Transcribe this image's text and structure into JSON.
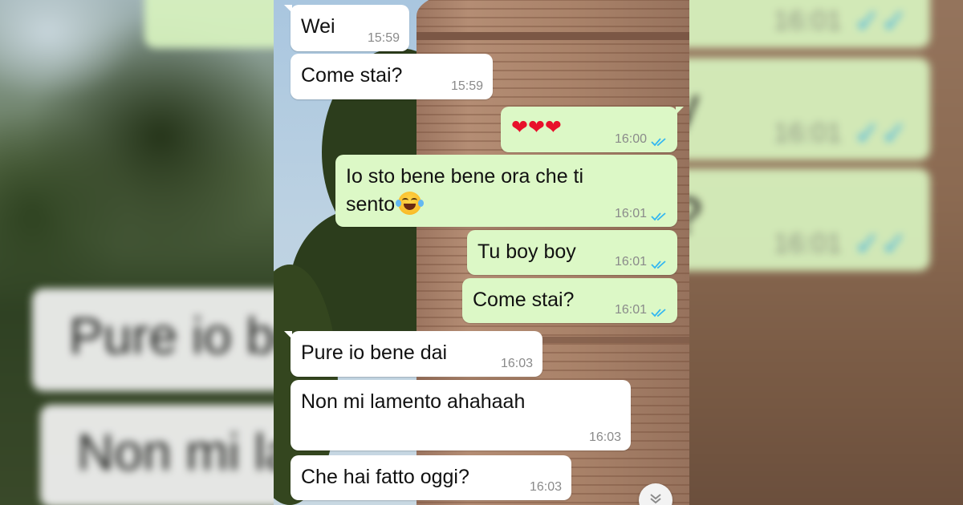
{
  "colors": {
    "incoming_bubble": "#ffffff",
    "outgoing_bubble": "#dcf8c6",
    "read_ticks": "#34b7f1",
    "timestamp": "#8a8a8a",
    "heart": "#e8102b"
  },
  "messages": [
    {
      "dir": "in",
      "text": "Wei",
      "time": "15:59"
    },
    {
      "dir": "in",
      "text": "Come stai?",
      "time": "15:59"
    },
    {
      "dir": "out",
      "text": "❤❤❤",
      "time": "16:00",
      "status": "read"
    },
    {
      "dir": "out",
      "text": "Io sto bene bene ora che ti\nsento",
      "emoji": "face-with-tears-of-joy",
      "time": "16:01",
      "status": "read"
    },
    {
      "dir": "out",
      "text": "Tu boy boy",
      "time": "16:01",
      "status": "read"
    },
    {
      "dir": "out",
      "text": "Come stai?",
      "time": "16:01",
      "status": "read"
    },
    {
      "dir": "in",
      "text": "Pure io bene dai",
      "time": "16:03"
    },
    {
      "dir": "in",
      "text": "Non mi lamento ahahaah",
      "time": "16:03"
    },
    {
      "dir": "in",
      "text": "Che hai fatto oggi?",
      "time": "16:03"
    }
  ],
  "blurred_background": {
    "left": [
      {
        "dir": "in",
        "text": "Pure io be"
      },
      {
        "dir": "in",
        "text": "Non mi la"
      }
    ],
    "right": [
      {
        "dir": "out",
        "text": "",
        "time": "16:01"
      },
      {
        "dir": "out",
        "text": "y",
        "time": "16:01"
      },
      {
        "dir": "out",
        "text": "?",
        "time": "16:01"
      }
    ]
  },
  "scroll_down_icon": "chevron-double-down-icon"
}
